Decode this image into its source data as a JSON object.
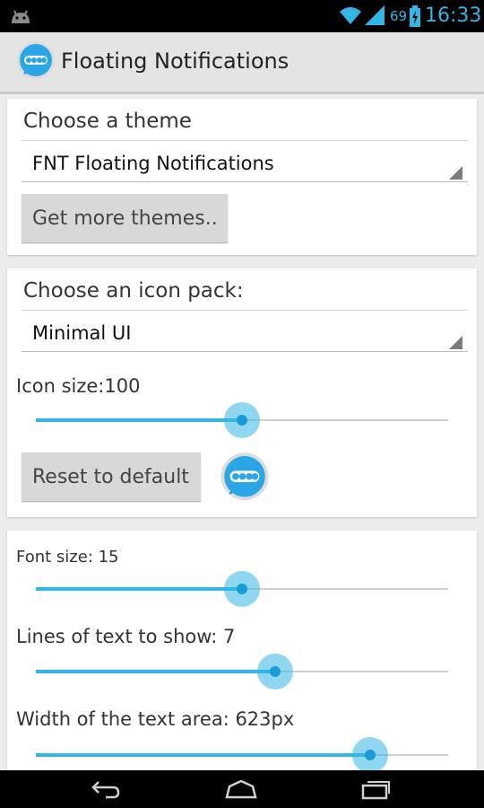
{
  "status_bar": {
    "battery_percent": "69",
    "time": "16:33",
    "icons": [
      "android-icon",
      "wifi-icon",
      "signal-icon",
      "battery-charging-icon"
    ]
  },
  "action_bar": {
    "title": "Floating Notifications",
    "icon": "chat-bubble-icon"
  },
  "theme_card": {
    "header": "Choose a theme",
    "selected_theme": "FNT Floating Notifications",
    "more_button": "Get more themes.."
  },
  "icon_card": {
    "header": "Choose an icon pack:",
    "selected_pack": "Minimal UI",
    "size_label": "Icon size:100",
    "size_slider_fraction": 0.5,
    "reset_button": "Reset to default",
    "preview_icon": "chat-bubble-icon"
  },
  "text_card": {
    "font_size_label": "Font size: 15",
    "font_size_fraction": 0.5,
    "lines_label": "Lines of text to show: 7",
    "lines_fraction": 0.58,
    "width_label": "Width of the text area: 623px",
    "width_fraction": 0.81
  },
  "colors": {
    "accent": "#33b5e5",
    "status_bar_bg": "#000000",
    "action_bar_bg": "#e4e4e4",
    "button_bg": "#d8d8d8"
  }
}
